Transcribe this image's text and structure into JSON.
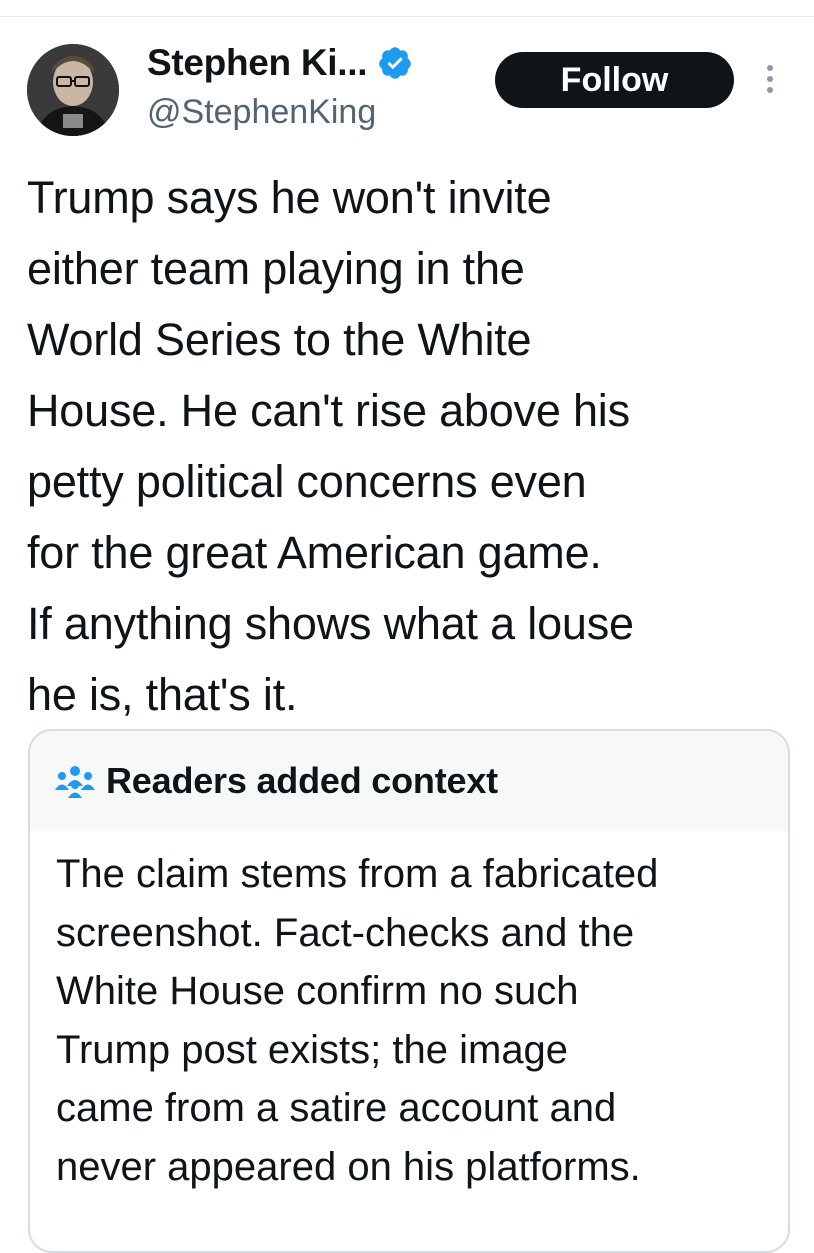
{
  "author": {
    "display_name": "Stephen Ki...",
    "handle": "@StephenKing",
    "verified": true,
    "verified_color": "#1d9bf0"
  },
  "actions": {
    "follow_label": "Follow",
    "more_icon": "more-vertical-icon"
  },
  "tweet": {
    "text": "Trump says he won't invite\neither team playing in the\nWorld Series to the White\nHouse. He can't rise above his\npetty political concerns even\nfor the great American game.\nIf anything shows what a louse\nhe is, that's it."
  },
  "community_note": {
    "icon": "people-icon",
    "icon_color": "#1d9bf0",
    "title": "Readers added context",
    "body": "The claim stems from a fabricated\nscreenshot. Fact-checks and the\nWhite House confirm no such\nTrump post exists; the image\ncame from a satire account and\nnever appeared on his platforms."
  },
  "colors": {
    "text": "#0f1419",
    "secondary_text": "#536471",
    "button_bg": "#0f1419",
    "card_header_bg": "#f7f9f9",
    "card_border": "#d4dde3"
  }
}
